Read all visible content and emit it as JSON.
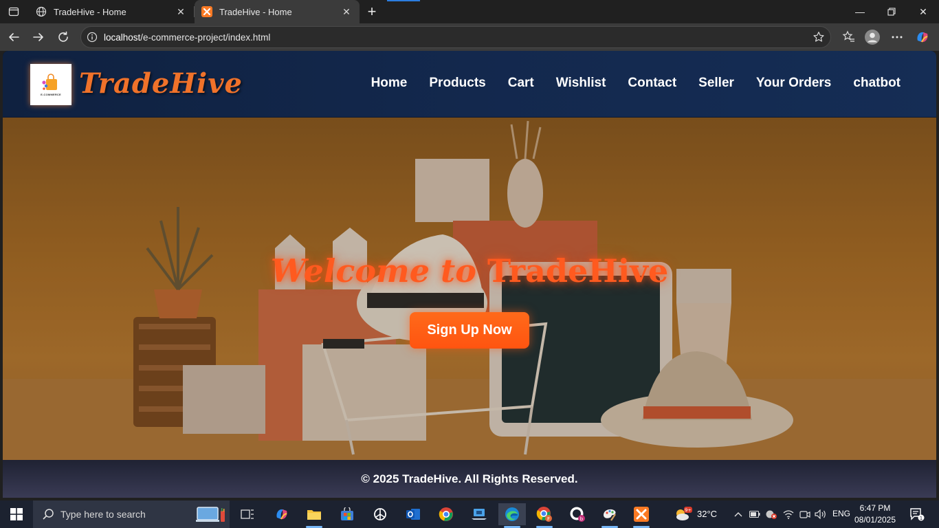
{
  "browser": {
    "tabs": [
      {
        "title": "TradeHive - Home"
      },
      {
        "title": "TradeHive - Home"
      }
    ],
    "address": {
      "host": "localhost",
      "path": "/e-commerce-project/index.html"
    }
  },
  "site": {
    "logo_caption": "E-COMMERCE",
    "brand": "TradeHive",
    "nav": [
      "Home",
      "Products",
      "Cart",
      "Wishlist",
      "Contact",
      "Seller",
      "Your Orders",
      "chatbot"
    ],
    "hero": {
      "title_script": "Welcome to",
      "title_plain": "TradeHive",
      "cta": "Sign Up Now"
    },
    "footer": "© 2025 TradeHive. All Rights Reserved."
  },
  "taskbar": {
    "search_placeholder": "Type here to search",
    "weather_temp": "32°C",
    "language": "ENG",
    "time": "6:47 PM",
    "date": "08/01/2025",
    "notification_count": "1",
    "weather_badge": "9+"
  },
  "colors": {
    "accent": "#ff5a1f",
    "header_bg": "#13284d",
    "hero_bg": "#a86d28",
    "cta_bg": "#ff5a1a"
  }
}
